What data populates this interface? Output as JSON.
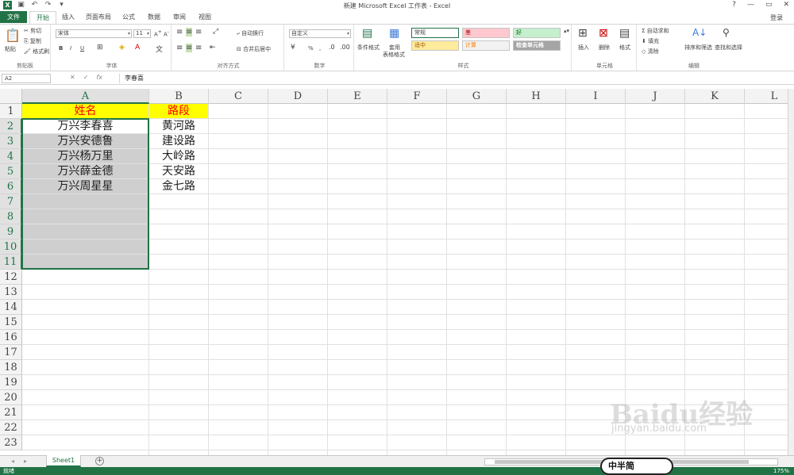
{
  "window": {
    "title": "新建 Microsoft Excel 工作表 - Excel",
    "controls": [
      "?",
      "—",
      "▭",
      "✕"
    ]
  },
  "tabs": [
    "文件",
    "开始",
    "插入",
    "页面布局",
    "公式",
    "数据",
    "审阅",
    "视图"
  ],
  "login_label": "登录",
  "ribbon": {
    "clipboard": {
      "paste": "粘贴",
      "cut": "剪切",
      "copy": "复制",
      "format_painter": "格式刷",
      "group": "剪贴板"
    },
    "font": {
      "name": "宋体",
      "size": "11",
      "bold": "B",
      "italic": "I",
      "underline": "U",
      "group": "字体"
    },
    "alignment": {
      "wrap": "自动换行",
      "merge": "合并后居中",
      "group": "对齐方式"
    },
    "number": {
      "format": "自定义",
      "percent": "%",
      "comma": ",",
      "group": "数字"
    },
    "styles": {
      "conditional": "条件格式",
      "table": "套用",
      "table2": "表格格式",
      "normal": "常规",
      "bad": "差",
      "good": "好",
      "neutral": "适中",
      "calc": "计算",
      "check": "检查单元格",
      "group": "样式"
    },
    "cells": {
      "insert": "插入",
      "delete": "删除",
      "format": "格式",
      "group": "单元格"
    },
    "editing": {
      "autosum": "自动求和",
      "fill": "填充",
      "clear": "清除",
      "sort": "排序和筛选",
      "find": "查找和选择",
      "group": "编辑"
    }
  },
  "formula_bar": {
    "name_box": "A2",
    "fx": "fx",
    "content": "李春喜"
  },
  "columns": [
    "A",
    "B",
    "C",
    "D",
    "E",
    "F",
    "G",
    "H",
    "I",
    "J",
    "K",
    "L"
  ],
  "rows": [
    "1",
    "2",
    "3",
    "4",
    "5",
    "6",
    "7",
    "8",
    "9",
    "10",
    "11",
    "12",
    "13",
    "14",
    "15",
    "16",
    "17",
    "18",
    "19",
    "20",
    "21",
    "22",
    "23"
  ],
  "sheet": {
    "header": {
      "a": "姓名",
      "b": "路段"
    },
    "data": [
      {
        "a": "万兴李春喜",
        "b": "黄河路"
      },
      {
        "a": "万兴安德鲁",
        "b": "建设路"
      },
      {
        "a": "万兴杨万里",
        "b": "大岭路"
      },
      {
        "a": "万兴薛金德",
        "b": "天安路"
      },
      {
        "a": "万兴周星星",
        "b": "金七路"
      }
    ]
  },
  "sheet_tab": "Sheet1",
  "status": {
    "ready": "就绪",
    "zoom": "175%"
  },
  "watermark": {
    "logo": "Baidu经验",
    "url": "jingyan.baidu.com",
    "badge": "中半简"
  },
  "colors": {
    "excel_green": "#217346",
    "header_fill": "#ffff00",
    "header_text": "#ff0000",
    "selection_fill": "#cfcfcf"
  }
}
